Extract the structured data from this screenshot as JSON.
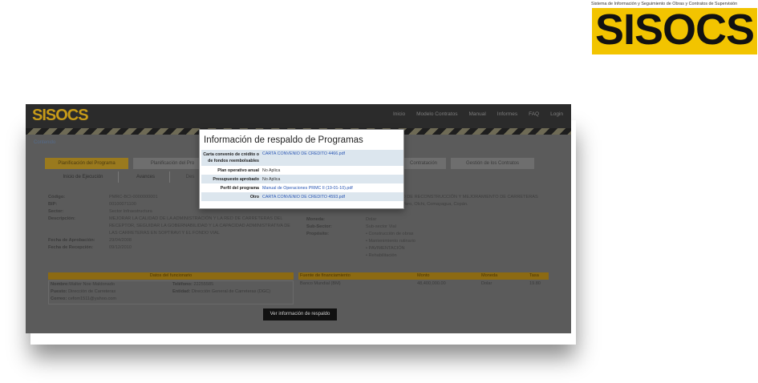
{
  "brand": {
    "tagline": "Sistema de Información y Seguimiento de Obras y Contratos de Supervisión",
    "logo_text": "SISOCS",
    "colors": {
      "yellow": "#f2c400",
      "black": "#111111"
    }
  },
  "app": {
    "logo_text": "SISOCS",
    "nav": [
      "Inicio",
      "Modelo Contratos",
      "Manual",
      "Informes",
      "FAQ",
      "Login"
    ],
    "breadcrumb": "Contenido",
    "tabs_row1": [
      "Planificación del Programa",
      "Planificación del Pro",
      "Contratación",
      "Gestión de los Contratos"
    ],
    "tabs_row2": [
      "Inicio de Ejecución",
      "Avances",
      "Des"
    ],
    "details_left": [
      {
        "label": "Código:",
        "value": "PMRC-BCI-0000000001"
      },
      {
        "label": "BIP:",
        "value": "00100071100"
      },
      {
        "label": "Sector:",
        "value": "Sector Infraestructura"
      },
      {
        "label": "Descripción:",
        "value": "MEJORAR LA CALIDAD DE LA ADMINISTRACIÓN Y LA RED DE CARRETERAS DEL RECEPTOR, SEGUIDAR LA GOBERNABILIDAD Y LA CAPACIDAD ADMINISTRATIVA DE LAS CARRETERAS EN SOPTRAVI Y EL FONDO VIAL"
      },
      {
        "label": "Fecha de Aprobación:",
        "value": "29/04/2008"
      },
      {
        "label": "Fecha de Recepción:",
        "value": "09/12/2010"
      }
    ],
    "details_right_top": "CTO DE RECONSTRUCCIÓN Y MEJORAMIENTO DE CARRETERAS",
    "details_right_top2": "ro, Yoro, Olchi, Comayagua, Copán.",
    "details_right": [
      {
        "label": "Moneda:",
        "value": "Dolar"
      },
      {
        "label": "Sub-Sector:",
        "value": "Sub-sector Vial"
      },
      {
        "label": "Propósito:",
        "value": ""
      }
    ],
    "purposes": [
      "Construcción de obras",
      "Mantenimiento rutinario",
      "PAVIMENTACIÓN",
      "Rehabilitación"
    ],
    "official": {
      "header": "Datos del funcionario",
      "nombre_label": "Nombre:",
      "nombre": "Walter Noe Maldonado",
      "telefono_label": "Teléfono:",
      "telefono": "22255585",
      "puesto_label": "Puesto:",
      "puesto": "Dirección de Carreteras",
      "entidad_label": "Entidad:",
      "entidad": "Dirección General de Carreteras (DGC)",
      "correo_label": "Correo:",
      "correo": "cefom1511@yahoo.com"
    },
    "funding": {
      "headers": [
        "Fuente de financiamiento",
        "Monto",
        "Moneda",
        "Tasa"
      ],
      "row": [
        "Banco Mundial (BM)",
        "48,400,000.00",
        "Dolar",
        "19.80"
      ]
    },
    "backup_button": "Ver información de respaldo"
  },
  "modal": {
    "title": "Información de respaldo de Programas",
    "rows": [
      {
        "label": "Carta convenio de crédito o de fondos reembolsables",
        "value": "CARTA CONVENIO DE CREDITO 4466.pdf",
        "is_link": true
      },
      {
        "label": "Plan operativo anual",
        "value": "No Aplica",
        "is_link": false
      },
      {
        "label": "Presupuesto aprobado",
        "value": "No Aplica",
        "is_link": false
      },
      {
        "label": "Perfil del programa",
        "value": "Manual de Operaciones PRMC II (19-01-10).pdf",
        "is_link": true
      },
      {
        "label": "Otro",
        "value": "CARTA CONVENIO DE CREDITO 4593.pdf",
        "is_link": true
      }
    ]
  }
}
